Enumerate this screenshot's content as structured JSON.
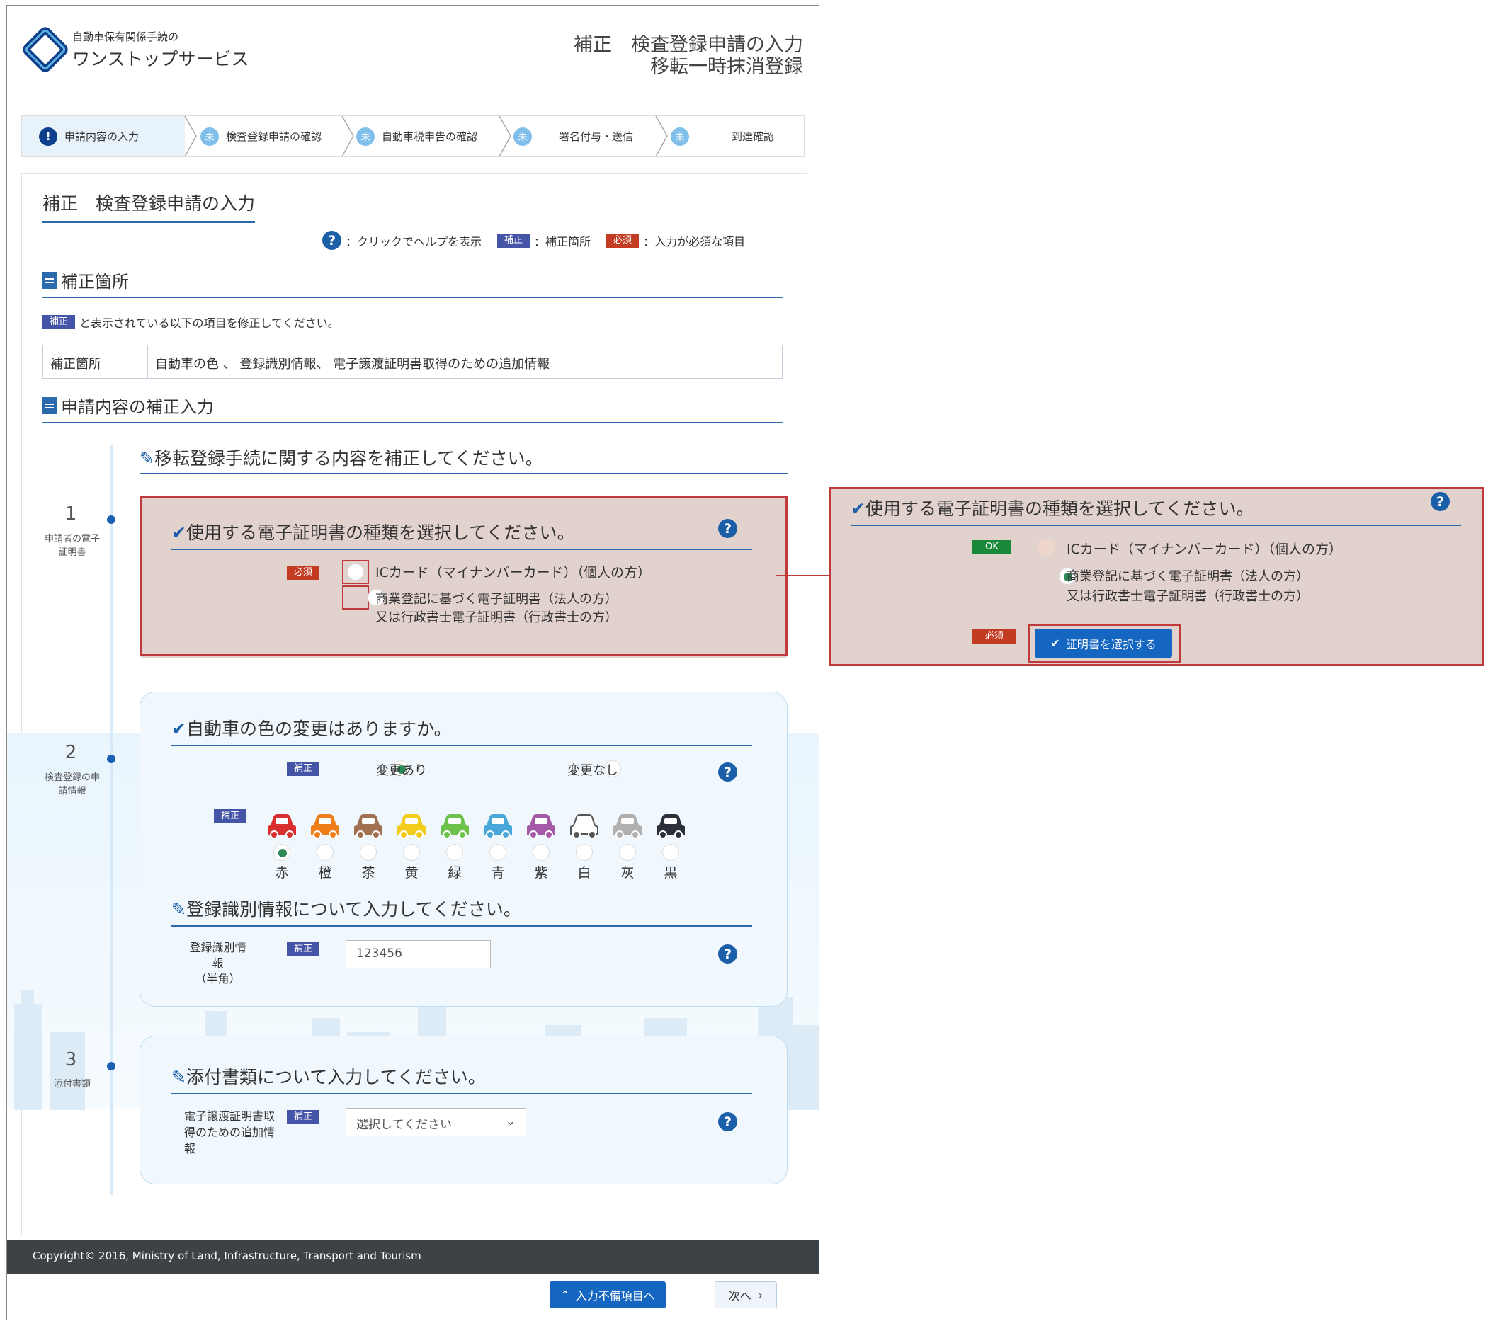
{
  "header": {
    "logo_small": "自動車保有関係手続の",
    "logo_big": "ワンストップサービス",
    "title_line1": "補正　検査登録申請の入力",
    "title_line2": "移転一時抹消登録"
  },
  "steps": [
    {
      "num": "!",
      "label": "申請内容の入力"
    },
    {
      "num": "未",
      "label": "検査登録申請の確認"
    },
    {
      "num": "未",
      "label": "自動車税申告の確認"
    },
    {
      "num": "未",
      "label": "署名付与・送信"
    },
    {
      "num": "未",
      "label": "到達確認"
    }
  ],
  "main_title": "補正　検査登録申請の入力",
  "legend": {
    "help_icon": "?",
    "help_text": "：クリックでヘルプを表示",
    "hosei_badge": "補正",
    "hosei_text": "：補正箇所",
    "hissu_badge": "必須",
    "hissu_text": "：入力が必須な項目"
  },
  "section1": {
    "title": "補正箇所",
    "note_badge": "補正",
    "note_text": "と表示されている以下の項目を修正してください。",
    "table_header": "補正箇所",
    "table_value": "自動車の色 、 登録識別情報、 電子譲渡証明書取得のための追加情報"
  },
  "section2": {
    "title": "申請内容の補正入力",
    "subhead": "移転登録手続に関する内容を補正してください。"
  },
  "timeline": [
    {
      "num": "1",
      "label": "申請者の電子証明書"
    },
    {
      "num": "2",
      "label": "検査登録の申請情報"
    },
    {
      "num": "3",
      "label": "添付書類"
    }
  ],
  "q1": {
    "title": "使用する電子証明書の種類を選択してください。",
    "badge": "必須",
    "opt1": "ICカード（マイナンバーカード）（個人の方）",
    "opt2_line1": "商業登記に基づく電子証明書（法人の方）",
    "opt2_line2": "又は行政書士電子証明書（行政書士の方）"
  },
  "q2": {
    "title": "自動車の色の変更はありますか。",
    "badge": "補正",
    "opt_yes": "変更あり",
    "opt_no": "変更なし",
    "colors_badge": "補正",
    "colors": [
      {
        "label": "赤",
        "color": "#d92f2f",
        "selected": true
      },
      {
        "label": "橙",
        "color": "#ef7d1a",
        "selected": false
      },
      {
        "label": "茶",
        "color": "#a07050",
        "selected": false
      },
      {
        "label": "黄",
        "color": "#f2cc1a",
        "selected": false
      },
      {
        "label": "緑",
        "color": "#6cc24a",
        "selected": false
      },
      {
        "label": "青",
        "color": "#4aa8d8",
        "selected": false
      },
      {
        "label": "紫",
        "color": "#a55aa8",
        "selected": false
      },
      {
        "label": "白",
        "color": "#ffffff",
        "selected": false
      },
      {
        "label": "灰",
        "color": "#b0b0b0",
        "selected": false
      },
      {
        "label": "黒",
        "color": "#2a2f3a",
        "selected": false
      }
    ]
  },
  "q3": {
    "title": "登録識別情報について入力してください。",
    "label_line1": "登録識別情報",
    "label_line2": "（半角）",
    "badge": "補正",
    "value": "123456"
  },
  "q4": {
    "title": "添付書類について入力してください。",
    "label_line1": "電子譲渡証明書取",
    "label_line2": "得のための追加情",
    "label_line3": "報",
    "badge": "補正",
    "select_value": "選択してください"
  },
  "footer": {
    "copyright": "Copyright© 2016, Ministry of Land, Infrastructure, Transport and Tourism"
  },
  "bottom_buttons": {
    "incomplete": "入力不備項目へ",
    "next": "次へ"
  },
  "zoom": {
    "title": "使用する電子証明書の種類を選択してください。",
    "ok_badge": "OK",
    "opt1": "ICカード（マイナンバーカード）（個人の方）",
    "opt2_line1": "商業登記に基づく電子証明書（法人の方）",
    "opt2_line2": "又は行政書士電子証明書（行政書士の方）",
    "hissu_badge": "必須",
    "select_btn": "証明書を選択する"
  }
}
